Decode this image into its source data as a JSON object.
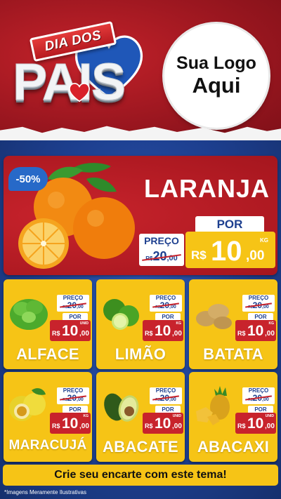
{
  "header": {
    "banner_text": "DIA DOS",
    "title_text": "PAIS",
    "logo_line1": "Sua Logo",
    "logo_line2": "Aqui"
  },
  "featured": {
    "discount_badge": "-50%",
    "name": "LARANJA",
    "preco_label": "PREÇO",
    "old_currency": "R$",
    "old_int": "20",
    "old_cents": ",00",
    "por_label": "POR",
    "currency": "R$",
    "price_int": "10",
    "price_cents": ",00",
    "unit": "KG"
  },
  "products": [
    {
      "name": "ALFACE",
      "preco_label": "PREÇO",
      "old_currency": "R$",
      "old_int": "20",
      "old_cents": ",00",
      "por_label": "POR",
      "currency": "R$",
      "price_int": "10",
      "price_cents": ",00",
      "unit": "UNID"
    },
    {
      "name": "LIMÃO",
      "preco_label": "PREÇO",
      "old_currency": "R$",
      "old_int": "20",
      "old_cents": ",00",
      "por_label": "POR",
      "currency": "R$",
      "price_int": "10",
      "price_cents": ",00",
      "unit": "KG"
    },
    {
      "name": "BATATA",
      "preco_label": "PREÇO",
      "old_currency": "R$",
      "old_int": "20",
      "old_cents": ",00",
      "por_label": "POR",
      "currency": "R$",
      "price_int": "10",
      "price_cents": ",00",
      "unit": "KG"
    },
    {
      "name": "MARACUJÁ",
      "preco_label": "PREÇO",
      "old_currency": "R$",
      "old_int": "20",
      "old_cents": ",00",
      "por_label": "POR",
      "currency": "R$",
      "price_int": "10",
      "price_cents": ",00",
      "unit": "KG"
    },
    {
      "name": "ABACATE",
      "preco_label": "PREÇO",
      "old_currency": "R$",
      "old_int": "20",
      "old_cents": ",00",
      "por_label": "POR",
      "currency": "R$",
      "price_int": "10",
      "price_cents": ",00",
      "unit": "UNID"
    },
    {
      "name": "ABACAXI",
      "preco_label": "PREÇO",
      "old_currency": "R$",
      "old_int": "20",
      "old_cents": ",00",
      "por_label": "POR",
      "currency": "R$",
      "price_int": "10",
      "price_cents": ",00",
      "unit": "UNID"
    }
  ],
  "footer": {
    "cta_text": "Crie seu encarte com este tema!",
    "footnote": "*Imagens Meramente Ilustrativas"
  },
  "colors": {
    "header_red": "#9d1720",
    "body_blue": "#1d3f8f",
    "card_yellow": "#f6c416",
    "price_red": "#c8232c",
    "badge_blue": "#2769c8"
  },
  "icons": [
    "orange-fruit-icon",
    "lettuce-icon",
    "lime-icon",
    "potato-icon",
    "passion-fruit-icon",
    "avocado-icon",
    "pineapple-icon",
    "heart-icon"
  ]
}
